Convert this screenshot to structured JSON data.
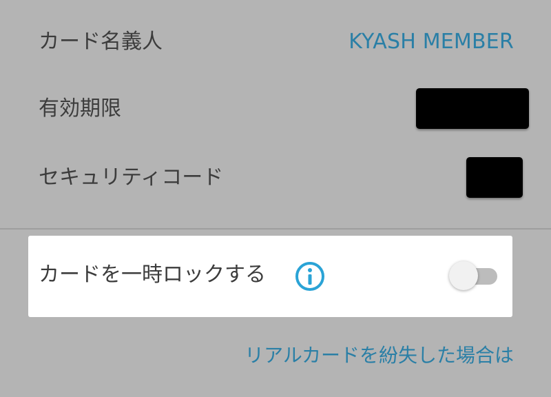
{
  "card_info": {
    "holder_label": "カード名義人",
    "holder_value": "KYASH MEMBER",
    "expiry_label": "有効期限",
    "security_code_label": "セキュリティコード"
  },
  "lock": {
    "label": "カードを一時ロックする",
    "info_icon": "info-icon",
    "enabled": false
  },
  "lost_card_link": "リアルカードを紛失した場合は",
  "colors": {
    "background": "#b4b4b4",
    "accent": "#2a7fa6",
    "card_surface": "#ffffff",
    "text": "#3c3c3c"
  }
}
